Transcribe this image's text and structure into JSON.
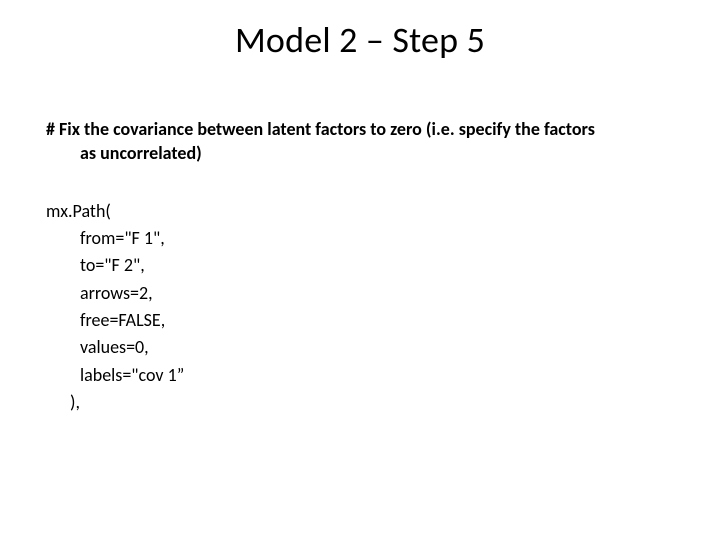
{
  "title": "Model 2 – Step 5",
  "comment": {
    "line1": "# Fix the covariance between latent factors to zero (i.e. specify the factors",
    "line2": "as uncorrelated)"
  },
  "code": {
    "open": "mx.Path(",
    "arg1": "from=\"F 1\",",
    "arg2": "to=\"F 2\",",
    "arg3": "arrows=2,",
    "arg4": "free=FALSE,",
    "arg5": "values=0,",
    "arg6": "labels=\"cov 1”",
    "close": "),"
  }
}
